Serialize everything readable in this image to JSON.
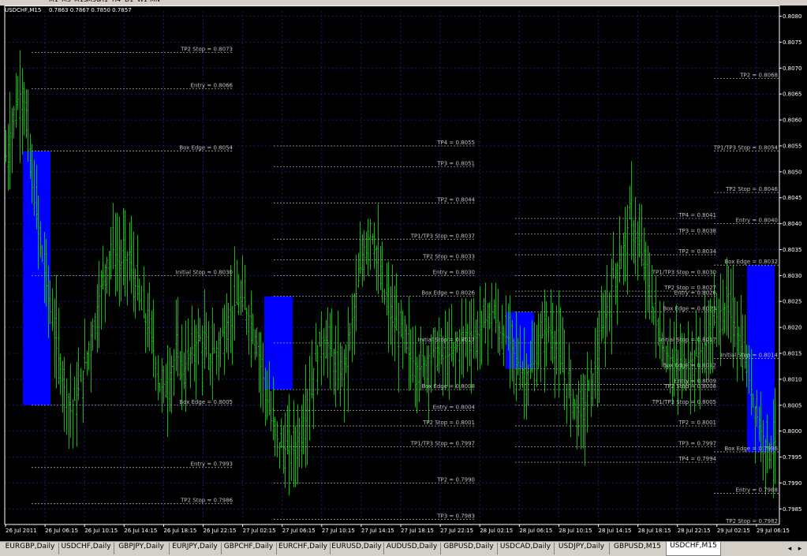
{
  "toolbar": {
    "timeframes": [
      "M1",
      "M5",
      "M15",
      "M30",
      "H1",
      "H4",
      "D1",
      "W1",
      "MN"
    ]
  },
  "chart": {
    "header_title": "USDCHF,M15",
    "header_ohlc": "0.7863 0.7867 0.7850 0.7857",
    "background_color": "#000000",
    "bull_color": "#00c000",
    "box_color": "#0000ff",
    "grid_color": "#1a1a7a"
  },
  "chart_data": {
    "type": "bar",
    "symbol": "USDCHF,M15",
    "ylim": [
      0.7982,
      0.8081
    ],
    "y_ticks": [
      "0.8080",
      "0.8075",
      "0.8070",
      "0.8065",
      "0.8060",
      "0.8055",
      "0.8050",
      "0.8045",
      "0.8040",
      "0.8035",
      "0.8030",
      "0.8025",
      "0.8020",
      "0.8015",
      "0.8010",
      "0.8005",
      "0.8000",
      "0.7995",
      "0.7990",
      "0.7985"
    ],
    "x_ticks": [
      "26 Jul 2011",
      "26 Jul 06:15",
      "26 Jul 10:15",
      "26 Jul 14:15",
      "26 Jul 18:15",
      "26 Jul 22:15",
      "27 Jul 02:15",
      "27 Jul 06:15",
      "27 Jul 10:15",
      "27 Jul 14:15",
      "27 Jul 18:15",
      "27 Jul 22:15",
      "28 Jul 02:15",
      "28 Jul 06:15",
      "28 Jul 10:15",
      "28 Jul 14:15",
      "28 Jul 18:15",
      "28 Jul 22:15",
      "29 Jul 02:15",
      "29 Jul 06:15"
    ],
    "price_path": [
      0.8053,
      0.8062,
      0.8066,
      0.805,
      0.8038,
      0.8028,
      0.8018,
      0.801,
      0.8004,
      0.8008,
      0.8015,
      0.8022,
      0.803,
      0.8036,
      0.8032,
      0.8034,
      0.8028,
      0.8022,
      0.8018,
      0.8008,
      0.801,
      0.8015,
      0.8012,
      0.8016,
      0.8018,
      0.8014,
      0.8016,
      0.802,
      0.8024,
      0.8025,
      0.8022,
      0.8017,
      0.8008,
      0.8,
      0.7997,
      0.7996,
      0.7998,
      0.8004,
      0.8012,
      0.8018,
      0.8016,
      0.801,
      0.8014,
      0.8024,
      0.8034,
      0.804,
      0.803,
      0.8024,
      0.802,
      0.8018,
      0.8014,
      0.8012,
      0.8014,
      0.8016,
      0.8014,
      0.8015,
      0.8017,
      0.8019,
      0.8018,
      0.8021,
      0.8023,
      0.8019,
      0.8018,
      0.8014,
      0.8011,
      0.8012,
      0.8018,
      0.802,
      0.8016,
      0.801,
      0.8006,
      0.8003,
      0.8008,
      0.8014,
      0.8022,
      0.803,
      0.8034,
      0.8041,
      0.8036,
      0.803,
      0.8022,
      0.8016,
      0.8014,
      0.8012,
      0.8013,
      0.8014,
      0.8016,
      0.8019,
      0.8023,
      0.8024,
      0.802,
      0.8015,
      0.8008,
      0.8001,
      0.7997,
      0.7998
    ],
    "boxes": [
      {
        "x_start": "26 Jul 02:00",
        "x_end": "26 Jul 05:45",
        "top": 0.8054,
        "bottom": 0.8005
      },
      {
        "x_start": "27 Jul 03:00",
        "x_end": "27 Jul 06:45",
        "top": 0.8026,
        "bottom": 0.8008
      },
      {
        "x_start": "28 Jul 03:00",
        "x_end": "28 Jul 06:45",
        "top": 0.8023,
        "bottom": 0.8012
      },
      {
        "x_start": "29 Jul 02:30",
        "x_end": "29 Jul 06:15",
        "top": 0.8032,
        "bottom": 0.7996
      }
    ],
    "levels": [
      {
        "session": 1,
        "label": "TP2 Stop = 0.8073",
        "value": 0.8073
      },
      {
        "session": 1,
        "label": "Entry = 0.8066",
        "value": 0.8066
      },
      {
        "session": 1,
        "label": "Box Edge = 0.8054",
        "value": 0.8054
      },
      {
        "session": 1,
        "label": "Initial Stop = 0.8030",
        "value": 0.803
      },
      {
        "session": 1,
        "label": "Box Edge = 0.8005",
        "value": 0.8005
      },
      {
        "session": 1,
        "label": "Entry = 0.7993",
        "value": 0.7993
      },
      {
        "session": 1,
        "label": "TP2 Stop = 0.7986",
        "value": 0.7986
      },
      {
        "session": 2,
        "label": "TP4 = 0.8055",
        "value": 0.8055
      },
      {
        "session": 2,
        "label": "TP3 = 0.8051",
        "value": 0.8051
      },
      {
        "session": 2,
        "label": "TP2 = 0.8044",
        "value": 0.8044
      },
      {
        "session": 2,
        "label": "TP1/TP3 Stop = 0.8037",
        "value": 0.8037
      },
      {
        "session": 2,
        "label": "TP2 Stop = 0.8033",
        "value": 0.8033
      },
      {
        "session": 2,
        "label": "Entry = 0.8030",
        "value": 0.803
      },
      {
        "session": 2,
        "label": "Box Edge = 0.8026",
        "value": 0.8026
      },
      {
        "session": 2,
        "label": "Initial Stop = 0.8017",
        "value": 0.8017
      },
      {
        "session": 2,
        "label": "Box Edge = 0.8008",
        "value": 0.8008
      },
      {
        "session": 2,
        "label": "Entry = 0.8004",
        "value": 0.8004
      },
      {
        "session": 2,
        "label": "TP2 Stop = 0.8001",
        "value": 0.8001
      },
      {
        "session": 2,
        "label": "TP1/TP3 Stop = 0.7997",
        "value": 0.7997
      },
      {
        "session": 2,
        "label": "TP2 = 0.7990",
        "value": 0.799
      },
      {
        "session": 2,
        "label": "TP3 = 0.7983",
        "value": 0.7983
      },
      {
        "session": 3,
        "label": "TP4 = 0.8041",
        "value": 0.8041
      },
      {
        "session": 3,
        "label": "TP3 = 0.8038",
        "value": 0.8038
      },
      {
        "session": 3,
        "label": "TP2 = 0.8034",
        "value": 0.8034
      },
      {
        "session": 3,
        "label": "TP1/TP3 Stop = 0.8030",
        "value": 0.803
      },
      {
        "session": 3,
        "label": "TP2 Stop = 0.8027",
        "value": 0.8027
      },
      {
        "session": 3,
        "label": "Entry = 0.8026",
        "value": 0.8026
      },
      {
        "session": 3,
        "label": "Box Edge = 0.8023",
        "value": 0.8023
      },
      {
        "session": 3,
        "label": "Initial Stop = 0.8017",
        "value": 0.8017
      },
      {
        "session": 3,
        "label": "Box Edge = 0.8012",
        "value": 0.8012
      },
      {
        "session": 3,
        "label": "Entry = 0.8009",
        "value": 0.8009
      },
      {
        "session": 3,
        "label": "TP2 Stop = 0.8008",
        "value": 0.8008
      },
      {
        "session": 3,
        "label": "TP1/TP3 Stop = 0.8005",
        "value": 0.8005
      },
      {
        "session": 3,
        "label": "TP2 = 0.8001",
        "value": 0.8001
      },
      {
        "session": 3,
        "label": "TP3 = 0.7997",
        "value": 0.7997
      },
      {
        "session": 3,
        "label": "TP4 = 0.7994",
        "value": 0.7994
      },
      {
        "session": 4,
        "label": "TP2 = 0.8068",
        "value": 0.8068
      },
      {
        "session": 4,
        "label": "TP1/TP3 Stop = 0.8054",
        "value": 0.8054
      },
      {
        "session": 4,
        "label": "TP2 Stop = 0.8046",
        "value": 0.8046
      },
      {
        "session": 4,
        "label": "Entry = 0.8040",
        "value": 0.804
      },
      {
        "session": 4,
        "label": "Box Edge = 0.8032",
        "value": 0.8032
      },
      {
        "session": 4,
        "label": "Initial Stop = 0.8014",
        "value": 0.8014
      },
      {
        "session": 4,
        "label": "Box Edge = 0.7996",
        "value": 0.7996
      },
      {
        "session": 4,
        "label": "Entry = 0.7988",
        "value": 0.7988
      },
      {
        "session": 4,
        "label": "TP2 Stop = 0.7982",
        "value": 0.7982
      }
    ]
  },
  "tabs": [
    {
      "label": "EURGBP,Daily",
      "active": false
    },
    {
      "label": "USDCHF,Daily",
      "active": false
    },
    {
      "label": "GBPJPY,Daily",
      "active": false
    },
    {
      "label": "EURJPY,Daily",
      "active": false
    },
    {
      "label": "GBPCHF,Daily",
      "active": false
    },
    {
      "label": "EURCHF,Daily",
      "active": false
    },
    {
      "label": "EURUSD,Daily",
      "active": false
    },
    {
      "label": "AUDUSD,Daily",
      "active": false
    },
    {
      "label": "GBPUSD,Daily",
      "active": false
    },
    {
      "label": "USDCAD,Daily",
      "active": false
    },
    {
      "label": "USDJPY,Daily",
      "active": false
    },
    {
      "label": "GBPUSD,M15",
      "active": false
    },
    {
      "label": "USDCHF,M15",
      "active": true
    }
  ],
  "tab_scroll": {
    "left": "◂",
    "right": "▸"
  }
}
